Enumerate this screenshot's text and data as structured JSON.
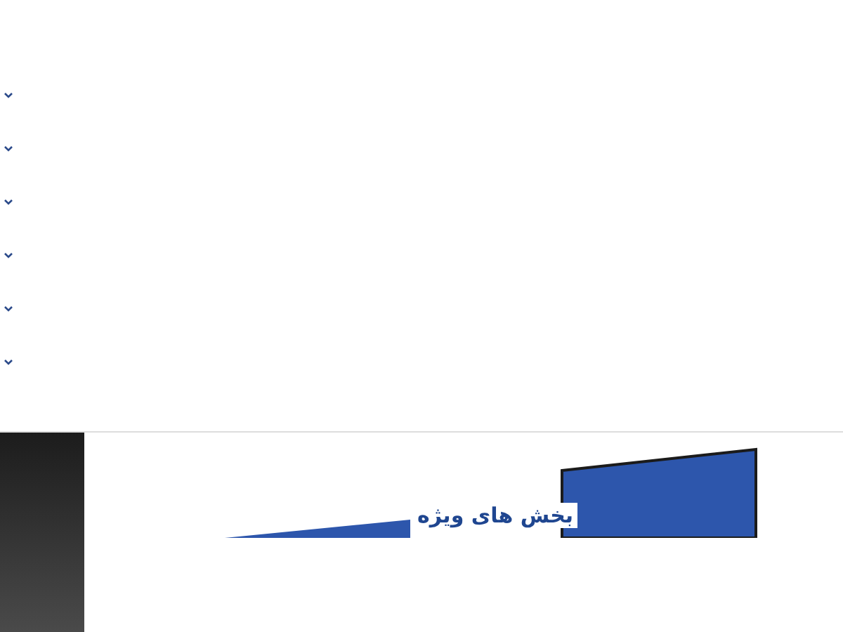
{
  "accordion": [
    {
      "expanded": false
    },
    {
      "expanded": false
    },
    {
      "expanded": false
    },
    {
      "expanded": false
    },
    {
      "expanded": false
    },
    {
      "expanded": false
    }
  ],
  "featured": {
    "heading": "بخش های ویژه"
  }
}
